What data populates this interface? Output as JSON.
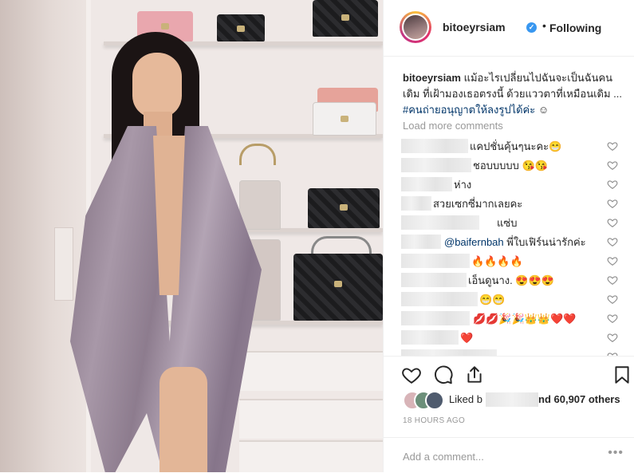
{
  "post": {
    "username": "bitoeyrsiam",
    "verified_glyph": "✓",
    "separator": "•",
    "follow_status": "Following"
  },
  "caption": {
    "username": "bitoeyrsiam",
    "text": " แม้อะไรเปลี่ยนไปฉันจะเป็นฉันคนเดิม ที่เฝ้ามองเธอตรงนี้ ด้วยแววตาที่เหมือนเดิม ... ",
    "hashtag": "#คนถ่ายอนุญาตให้ลงรูปได้ค่ะ",
    "emoji": " ☺"
  },
  "load_more": "Load more comments",
  "comments": [
    {
      "text": "แคปชั่นคุ้นๆนะคะ😁",
      "mention": ""
    },
    {
      "text": "ชอบบบบบ 😘😘",
      "mention": ""
    },
    {
      "text": "ห่าง",
      "mention": ""
    },
    {
      "text": "สวยเซกซี่มากเลยคะ",
      "mention": ""
    },
    {
      "text": "แซ่บ",
      "mention": ""
    },
    {
      "text": " พี่ใบเฟิร์นน่ารักค่ะ",
      "mention": "@baifernbah"
    },
    {
      "text": "🔥🔥🔥🔥",
      "mention": ""
    },
    {
      "text": "เอ็นดูนาง. 😍😍😍",
      "mention": ""
    },
    {
      "text": "😁😁",
      "mention": ""
    },
    {
      "text": "💋💋🎉🎉👑👑❤️❤️",
      "mention": ""
    },
    {
      "text": "❤️",
      "mention": ""
    },
    {
      "text": "...",
      "mention": ""
    }
  ],
  "likes": {
    "prefix": "Liked b",
    "suffix": "nd 60,907 others",
    "count": 60907
  },
  "timestamp": "18 HOURS AGO",
  "add_comment": {
    "placeholder": "Add a comment...",
    "more_glyph": "•••"
  },
  "icons": [
    "verified-badge-icon",
    "heart-icon",
    "comment-icon",
    "share-icon",
    "bookmark-icon",
    "more-options-icon"
  ],
  "colors": {
    "accent_blue": "#3897f0",
    "text": "#262626",
    "muted": "#999999",
    "link": "#003569",
    "border": "#efefef"
  }
}
